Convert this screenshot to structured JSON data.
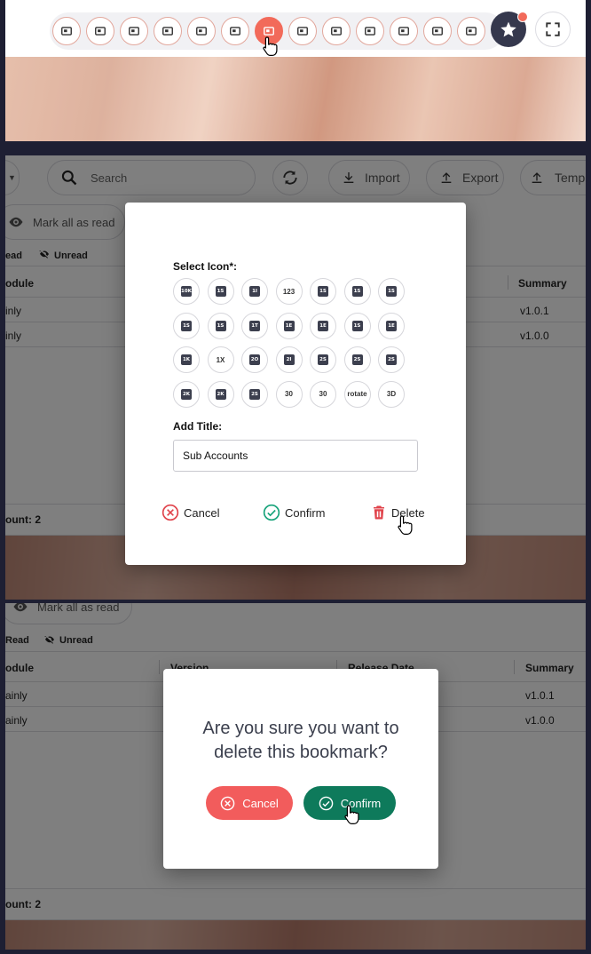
{
  "toolbar": {
    "bookmark_icons": [
      "contact-card-icon",
      "building-icon",
      "calendar-icon",
      "satellite-icon",
      "mail-open-icon",
      "settings-gear-icon",
      "sub-accounts-icon",
      "numbered-box-icon",
      "image-icon",
      "bookmark-icon",
      "keyboard-icon",
      "code-icon",
      "hidden-video-icon"
    ],
    "active_index": 6,
    "accent_color": "#f26a5a",
    "star_button_color": "#35384d"
  },
  "background_page": {
    "search_placeholder": "Search",
    "import_label": "Import",
    "export_label": "Export",
    "template_label": "Templa",
    "mark_all_label": "Mark all as read",
    "read_label": "ead",
    "read_label_2": "Read",
    "unread_label": "Unread",
    "columns": [
      "odule",
      "Version",
      "Release Date",
      "Summary"
    ],
    "rows": [
      {
        "module": "inly",
        "summary": "v1.0.1"
      },
      {
        "module": "inly",
        "summary": "v1.0.0"
      }
    ],
    "rows_2": [
      {
        "module": "ainly",
        "summary": "v1.0.1"
      },
      {
        "module": "ainly",
        "summary": "v1.0.0"
      }
    ],
    "count_label": "ount: 2"
  },
  "icon_modal": {
    "select_icon_label": "Select Icon*:",
    "icon_options": [
      "10K",
      "1S",
      "1I",
      "123",
      "1S",
      "1S",
      "1S",
      "1S",
      "1S",
      "1T",
      "1E",
      "1E",
      "1S",
      "1E",
      "1K",
      "1X",
      "2O",
      "2I",
      "2S",
      "2S",
      "2S",
      "2K",
      "2K",
      "2S",
      "30",
      "30",
      "rotate",
      "3D"
    ],
    "add_title_label": "Add Title:",
    "title_value": "Sub Accounts",
    "cancel_label": "Cancel",
    "confirm_label": "Confirm",
    "delete_label": "Delete",
    "cancel_color": "#e0434b",
    "confirm_color": "#17a37a",
    "delete_color": "#e0434b"
  },
  "confirm_modal": {
    "question": "Are you sure you want to delete this bookmark?",
    "cancel_label": "Cancel",
    "confirm_label": "Confirm",
    "cancel_color": "#f25c5c",
    "confirm_color": "#0e7a5b"
  }
}
